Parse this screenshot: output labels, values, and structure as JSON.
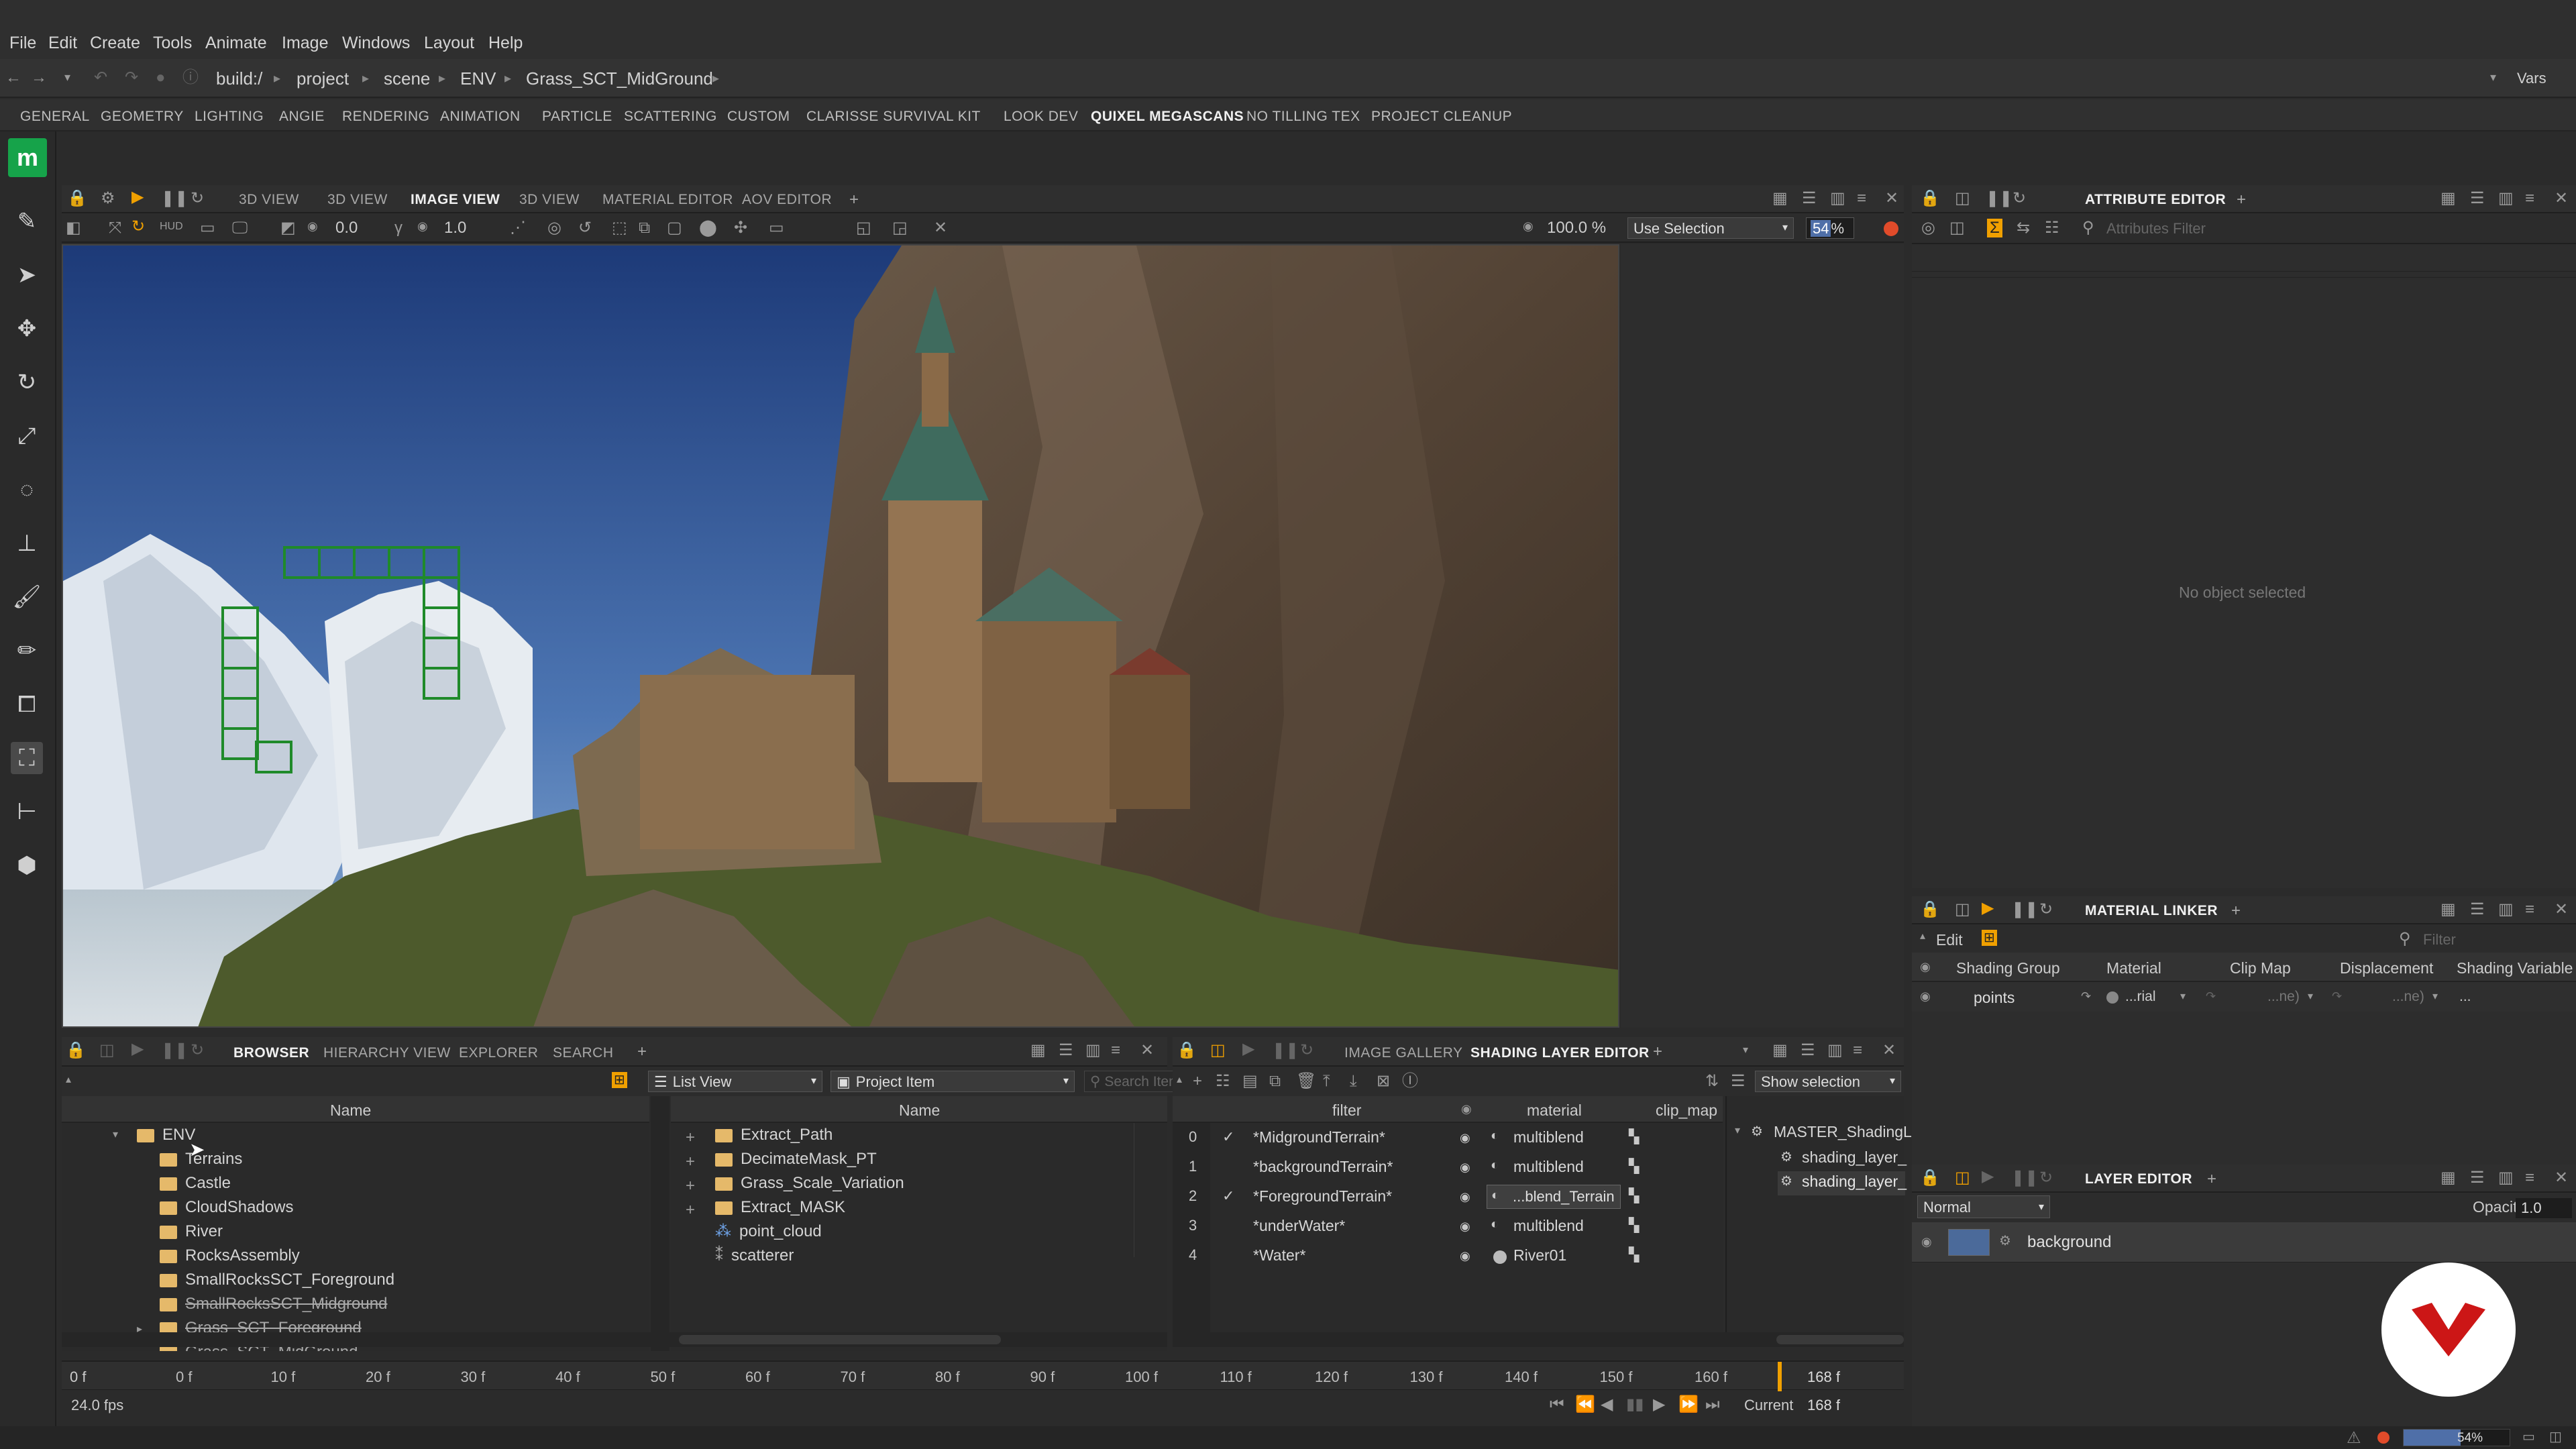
{
  "menu": [
    "File",
    "Edit",
    "Create",
    "Tools",
    "Animate",
    "Image",
    "Windows",
    "Layout",
    "Help"
  ],
  "breadcrumb": [
    "build:/",
    "project",
    "scene",
    "ENV",
    "Grass_SCT_MidGround"
  ],
  "vars_label": "Vars",
  "shelf_tabs": [
    "GENERAL",
    "GEOMETRY",
    "LIGHTING",
    "ANGIE",
    "RENDERING",
    "ANIMATION",
    "PARTICLE",
    "SCATTERING",
    "CUSTOM",
    "CLARISSE SURVIVAL KIT",
    "LOOK DEV",
    "QUIXEL MEGASCANS",
    "NO TILLING TEX",
    "PROJECT CLEANUP"
  ],
  "shelf_active": "QUIXEL MEGASCANS",
  "viewport": {
    "tabs": [
      "3D VIEW",
      "3D VIEW",
      "IMAGE VIEW",
      "3D VIEW",
      "MATERIAL EDITOR",
      "AOV EDITOR",
      "+"
    ],
    "active_tab": "IMAGE VIEW",
    "hud_label": "HUD",
    "exposure": "0.0",
    "gamma": "1.0",
    "zoom": "100.0 %",
    "selection_mode": "Use Selection",
    "sampling": "54",
    "sampling_unit": "%"
  },
  "attribute_editor": {
    "tab": "ATTRIBUTE EDITOR",
    "filter_placeholder": "Attributes Filter",
    "empty_text": "No object selected"
  },
  "material_linker": {
    "tab": "MATERIAL LINKER",
    "edit_label": "Edit",
    "filter_placeholder": "Filter",
    "columns": [
      "Shading Group",
      "Material",
      "Clip Map",
      "Displacement",
      "Shading Variable"
    ],
    "row": {
      "group": "points",
      "material": "...rial",
      "clip": "...ne)",
      "displacement": "...ne)",
      "variable": "..."
    }
  },
  "layer_editor": {
    "tab": "LAYER EDITOR",
    "blend_mode": "Normal",
    "opacity_label": "Opacity",
    "opacity": "1.0",
    "layers": [
      "background"
    ]
  },
  "browser": {
    "tabs": [
      "BROWSER",
      "HIERARCHY VIEW",
      "EXPLORER",
      "SEARCH",
      "+"
    ],
    "active_tab": "BROWSER",
    "view_mode": "List View",
    "filter": "Project Item",
    "search_placeholder": "Search Items",
    "tree_header": "Name",
    "list_header": "Name",
    "tree": [
      "ENV",
      "Terrains",
      "Castle",
      "CloudShadows",
      "River",
      "RocksAssembly",
      "SmallRocksSCT_Foreground",
      "SmallRocksSCT_Midground",
      "Grass_SCT_Foreground",
      "Grass_SCT_MidGround"
    ],
    "items": [
      "Extract_Path",
      "DecimateMask_PT",
      "Grass_Scale_Variation",
      "Extract_MASK",
      "point_cloud",
      "scatterer"
    ]
  },
  "shading": {
    "tabs": [
      "IMAGE GALLERY",
      "SHADING LAYER EDITOR",
      "+"
    ],
    "active_tab": "SHADING LAYER EDITOR",
    "show_selection": "Show selection",
    "columns": [
      "filter",
      "material",
      "clip_map"
    ],
    "rows": [
      {
        "idx": "0",
        "filter": "*MidgroundTerrain*",
        "material": "multiblend",
        "checked": true
      },
      {
        "idx": "1",
        "filter": "*backgroundTerrain*",
        "material": "multiblend",
        "checked": false
      },
      {
        "idx": "2",
        "filter": "*ForegroundTerrain*",
        "material": "...blend_Terrain",
        "checked": true
      },
      {
        "idx": "3",
        "filter": "*underWater*",
        "material": "multiblend",
        "checked": false
      },
      {
        "idx": "4",
        "filter": "*Water*",
        "material": "River01",
        "checked": false
      }
    ],
    "tree": [
      "MASTER_ShadingL",
      "shading_layer_",
      "shading_layer_"
    ]
  },
  "timeline": {
    "start": "0 f",
    "fps": "24.0 fps",
    "ticks": [
      "0 f",
      "10 f",
      "20 f",
      "30 f",
      "40 f",
      "50 f",
      "60 f",
      "70 f",
      "80 f",
      "90 f",
      "100 f",
      "110 f",
      "120 f",
      "130 f",
      "140 f",
      "150 f",
      "160 f"
    ],
    "end": "168 f",
    "current_label": "Current",
    "current": "168 f"
  },
  "status": {
    "progress": "54%",
    "progress_value": 54
  },
  "colors": {
    "accent": "#f0a000",
    "brand": "#16a34a",
    "record": "#e14b2a"
  }
}
